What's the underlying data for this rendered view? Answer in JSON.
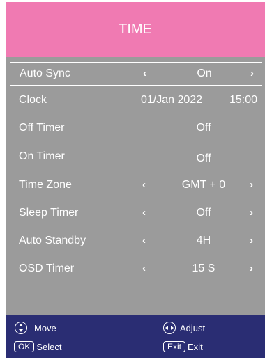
{
  "header": {
    "title": "TIME",
    "color": "#f07ab2"
  },
  "menu_background": "#9b9b9b",
  "footer_background": "#2a2d73",
  "rows": [
    {
      "label": "Auto Sync",
      "value": "On",
      "has_arrows": true,
      "selected": true
    },
    {
      "label": "Clock",
      "date": "01/Jan 2022",
      "time": "15:00",
      "has_arrows": false
    },
    {
      "label": "Off Timer",
      "value": "Off",
      "has_arrows": false
    },
    {
      "label": "On Timer",
      "value": "Off",
      "has_arrows": false
    },
    {
      "label": "Time Zone",
      "value": "GMT + 0",
      "has_arrows": true
    },
    {
      "label": "Sleep Timer",
      "value": "Off",
      "has_arrows": true
    },
    {
      "label": "Auto Standby",
      "value": "4H",
      "has_arrows": true
    },
    {
      "label": "OSD Timer",
      "value": "15 S",
      "has_arrows": true
    }
  ],
  "arrows": {
    "left": "‹",
    "right": "›"
  },
  "footer": {
    "move": {
      "icon": "up-down-icon",
      "label": "Move"
    },
    "adjust": {
      "icon": "left-right-icon",
      "label": "Adjust"
    },
    "select": {
      "key": "OK",
      "label": "Select"
    },
    "exit": {
      "key": "Exit",
      "label": "Exit"
    }
  }
}
